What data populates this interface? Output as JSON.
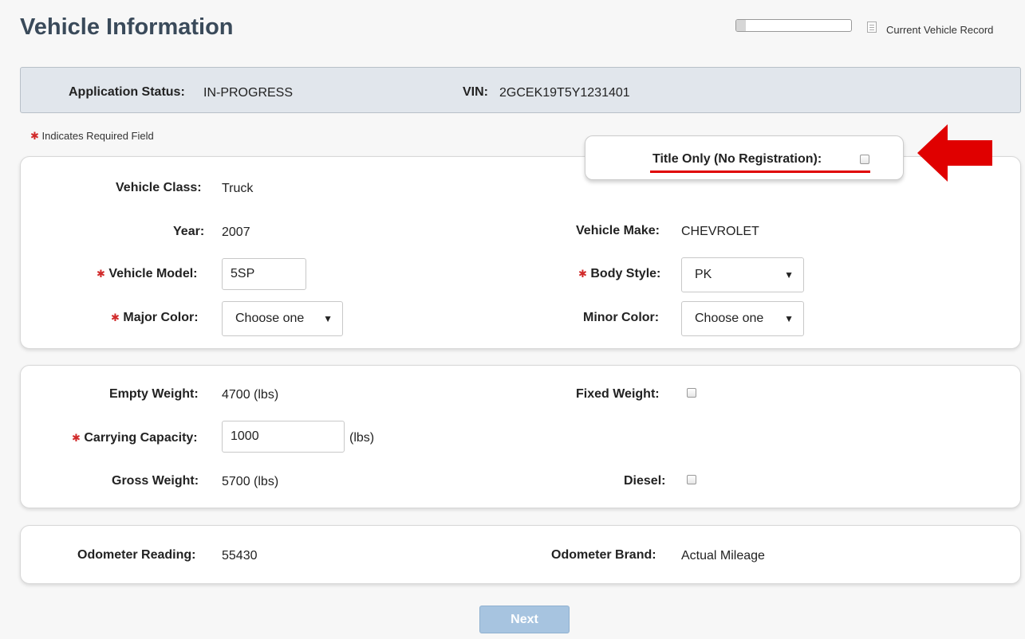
{
  "header": {
    "title": "Vehicle Information",
    "progress_fraction": 0.08,
    "record_link": "Current Vehicle Record"
  },
  "status": {
    "app_status_label": "Application Status:",
    "app_status_value": "IN-PROGRESS",
    "vin_label": "VIN:",
    "vin_value": "2GCEK19T5Y1231401"
  },
  "required_note": "Indicates Required Field",
  "title_only": {
    "label": "Title Only (No Registration):",
    "checked": false
  },
  "vehicle": {
    "class_label": "Vehicle Class:",
    "class_value": "Truck",
    "year_label": "Year:",
    "year_value": "2007",
    "make_label": "Vehicle Make:",
    "make_value": "CHEVROLET",
    "model_label": "Vehicle Model:",
    "model_value": "5SP",
    "body_label": "Body Style:",
    "body_value": "PK",
    "major_color_label": "Major Color:",
    "major_color_value": "Choose one",
    "minor_color_label": "Minor Color:",
    "minor_color_value": "Choose one"
  },
  "weight": {
    "empty_label": "Empty Weight:",
    "empty_value": "4700 (lbs)",
    "fixed_label": "Fixed Weight:",
    "capacity_label": "Carrying Capacity:",
    "capacity_value": "1000",
    "capacity_unit": "(lbs)",
    "gross_label": "Gross Weight:",
    "gross_value": "5700 (lbs)",
    "diesel_label": "Diesel:"
  },
  "odometer": {
    "reading_label": "Odometer Reading:",
    "reading_value": "55430",
    "brand_label": "Odometer Brand:",
    "brand_value": "Actual Mileage"
  },
  "next_label": "Next",
  "star_glyph": "✱",
  "caret_glyph": "▼",
  "colors": {
    "required_star": "#d12a2a",
    "annotation_red": "#e00000",
    "next_button": "#a7c4e0"
  }
}
